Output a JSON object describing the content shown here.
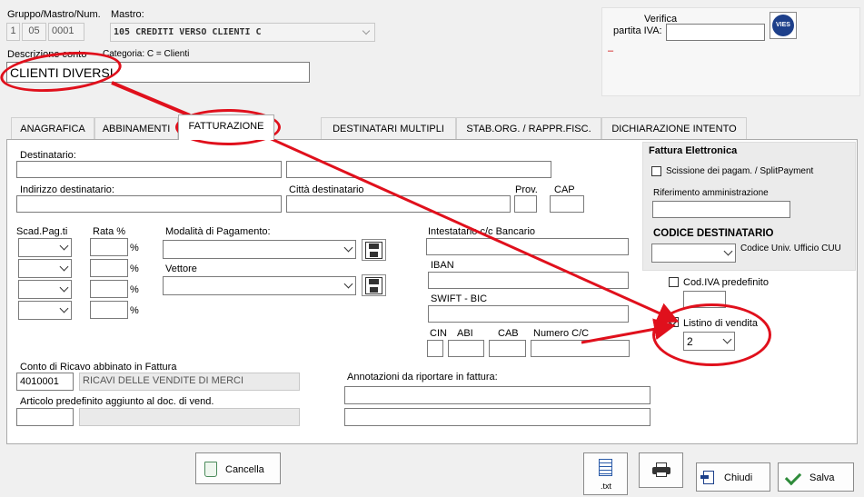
{
  "header": {
    "gruppo_label": "Gruppo/Mastro/Num.",
    "gruppo": "1",
    "mastro_num": "05",
    "num": "0001",
    "mastro_label": "Mastro:",
    "mastro_value": "105 CREDITI VERSO CLIENTI C",
    "descrizione_label": "Descrizione conto",
    "descrizione_value": "CLIENTI DIVERSI",
    "categoria": "Categoria: C = Clienti",
    "verifica_label_1": "Verifica",
    "verifica_label_2": "partita IVA:",
    "verifica_dash": "–",
    "vies_badge": "VIES"
  },
  "tabs": [
    {
      "label": "ANAGRAFICA"
    },
    {
      "label": "ABBINAMENTI"
    },
    {
      "label": "FATTURAZIONE"
    },
    {
      "label": "DESTINATARI MULTIPLI"
    },
    {
      "label": "STAB.ORG. / RAPPR.FISC."
    },
    {
      "label": "DICHIARAZIONE INTENTO"
    }
  ],
  "billing": {
    "destinatario_label": "Destinatario:",
    "indirizzo_label": "Indirizzo destinatario:",
    "citta_label": "Città destinatario",
    "prov_label": "Prov.",
    "cap_label": "CAP",
    "scad_label": "Scad.Pag.ti",
    "rata_label": "Rata %",
    "pct_sign": "%",
    "modalita_label": "Modalità di Pagamento:",
    "vettore_label": "Vettore",
    "intestatario_label": "Intestatario c/c Bancario",
    "iban_label": "IBAN",
    "swift_label": "SWIFT - BIC",
    "cin_label": "CIN",
    "abi_label": "ABI",
    "cab_label": "CAB",
    "numero_cc_label": "Numero C/C",
    "conto_ricavo_label": "Conto di Ricavo abbinato in Fattura",
    "conto_ricavo_code": "4010001",
    "conto_ricavo_desc": "RICAVI DELLE VENDITE DI MERCI",
    "articolo_label": "Articolo predefinito aggiunto  al doc. di vend.",
    "annotazioni_label": "Annotazioni da riportare in fattura:"
  },
  "fattura_elettronica": {
    "title": "Fattura Elettronica",
    "split_label": "Scissione dei pagam. / SplitPayment",
    "rif_label": "Riferimento amministrazione",
    "codice_dest_label": "CODICE DESTINATARIO",
    "codice_univ_label": "Codice Univ. Ufficio CUU"
  },
  "right_options": {
    "cod_iva_label": "Cod.IVA predefinito",
    "listino_label": "Listino di vendita",
    "listino_value": "2",
    "listino_checked": true
  },
  "footer": {
    "cancella": "Cancella",
    "txt": ".txt",
    "chiudi": "Chiudi",
    "salva": "Salva"
  },
  "colors": {
    "annotation_red": "#e0101c",
    "vies_blue": "#1d3f8a",
    "salva_green": "#2e8b3a"
  }
}
